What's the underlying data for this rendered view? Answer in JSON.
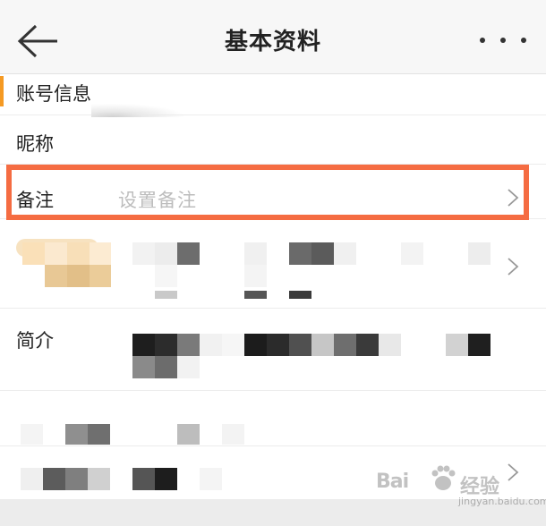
{
  "navbar": {
    "title": "基本资料",
    "back_icon": "arrow-left-icon",
    "more_icon": "more-dots-icon"
  },
  "account_section": {
    "title": "账号信息"
  },
  "fields": {
    "nickname": {
      "label": "昵称"
    },
    "remark": {
      "label": "备注",
      "placeholder": "设置备注"
    },
    "intro": {
      "label": "简介"
    }
  },
  "colors": {
    "highlight_border": "#f56c42",
    "section_accent": "#f59a23"
  },
  "watermark": {
    "brand": "Bai",
    "brand_tail": "经验",
    "url": "jingyan.baidu.com"
  }
}
